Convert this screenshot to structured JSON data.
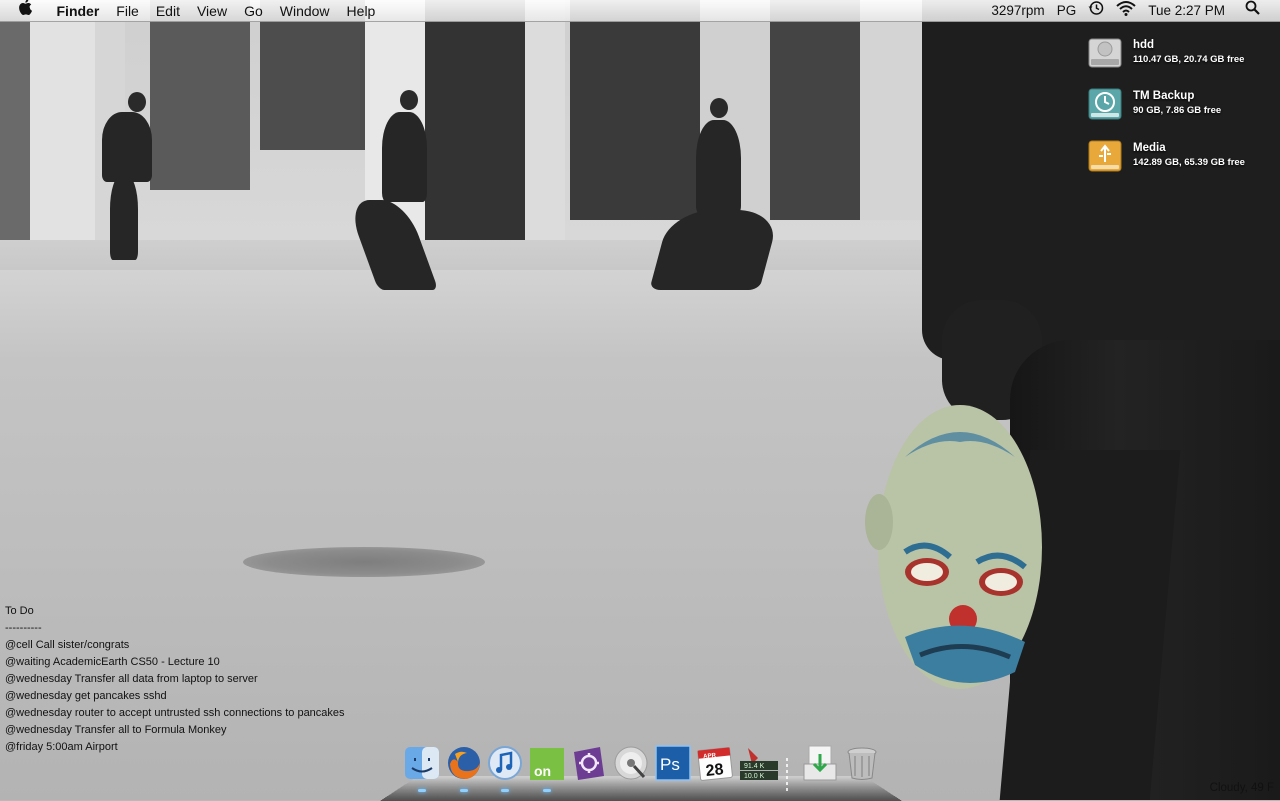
{
  "menubar": {
    "app_name": "Finder",
    "menus": [
      "File",
      "Edit",
      "View",
      "Go",
      "Window",
      "Help"
    ],
    "fan_speed": "3297rpm",
    "user_initials": "PG",
    "clock": "Tue 2:27 PM",
    "icons": [
      "apple-icon",
      "time-machine-icon",
      "wifi-icon",
      "spotlight-icon"
    ]
  },
  "drives": [
    {
      "name": "hdd",
      "info": "110.47 GB, 20.74 GB free",
      "icon": "hard-drive-icon"
    },
    {
      "name": "TM Backup",
      "info": "90 GB, 7.86 GB free",
      "icon": "time-machine-drive-icon"
    },
    {
      "name": "Media",
      "info": "142.89 GB, 65.39 GB free",
      "icon": "usb-drive-icon"
    }
  ],
  "todo": {
    "title": "To Do",
    "separator": "----------",
    "items": [
      "@cell Call sister/congrats",
      "@waiting AcademicEarth CS50 - Lecture 10",
      "@wednesday Transfer all data from laptop to server",
      "@wednesday get pancakes sshd",
      "@wednesday router to accept untrusted ssh connections to pancakes",
      "@wednesday Transfer all to Formula Monkey",
      "@friday 5:00am Airport"
    ]
  },
  "dock": {
    "items": [
      {
        "name": "finder-icon",
        "running": true
      },
      {
        "name": "firefox-icon",
        "running": true
      },
      {
        "name": "itunes-icon",
        "running": true
      },
      {
        "name": "on-app-icon",
        "label": "on",
        "running": true
      },
      {
        "name": "script-editor-icon",
        "running": false
      },
      {
        "name": "dvd-player-icon",
        "running": false
      },
      {
        "name": "photoshop-icon",
        "label": "Ps",
        "running": false
      },
      {
        "name": "calendar-icon",
        "label": "28",
        "month": "APR",
        "running": false
      },
      {
        "name": "network-monitor-icon",
        "up": "91.4 K",
        "down": "10.0 K",
        "running": false
      },
      {
        "name": "downloads-icon",
        "running": false
      },
      {
        "name": "trash-icon",
        "running": false
      }
    ]
  },
  "weather": "Cloudy, 49 F",
  "colors": {
    "menubar": "#ececec",
    "photoshop_blue": "#1c5fa8",
    "media_drive": "#e8a83a",
    "tm_drive": "#5aa6a8"
  }
}
